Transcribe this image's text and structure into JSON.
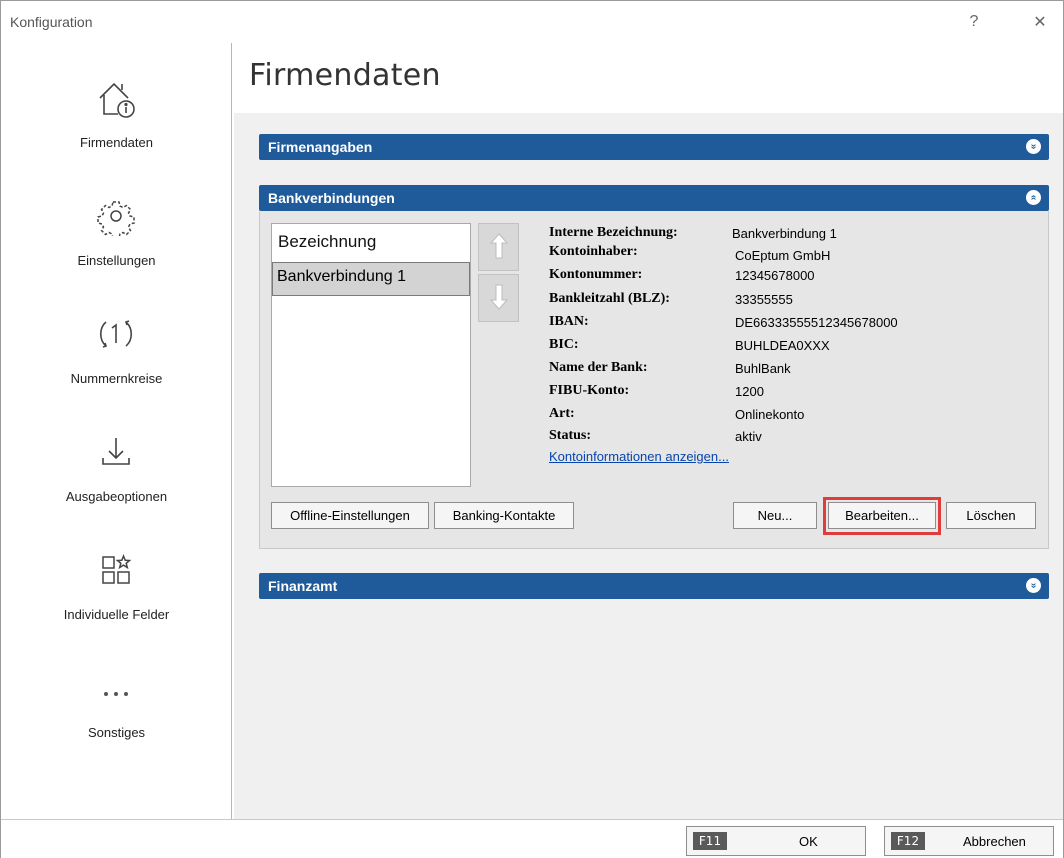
{
  "window": {
    "title": "Konfiguration",
    "help_glyph": "?",
    "close_glyph": "✕"
  },
  "sidebar": {
    "items": [
      {
        "label": "Firmendaten",
        "icon": "house-info-icon"
      },
      {
        "label": "Einstellungen",
        "icon": "gear-icon"
      },
      {
        "label": "Nummernkreise",
        "icon": "number-cycle-icon"
      },
      {
        "label": "Ausgabeoptionen",
        "icon": "download-icon"
      },
      {
        "label": "Individuelle Felder",
        "icon": "grid-star-icon"
      },
      {
        "label": "Sonstiges",
        "icon": "more-dots-icon"
      }
    ]
  },
  "main": {
    "page_title": "Firmendaten",
    "sections": {
      "firmenangaben": {
        "label": "Firmenangaben",
        "toggle": "»",
        "state": "collapsed"
      },
      "bankverbindungen": {
        "label": "Bankverbindungen",
        "toggle": "«",
        "state": "expanded"
      },
      "finanzamt": {
        "label": "Finanzamt",
        "toggle": "»",
        "state": "collapsed"
      }
    },
    "bank": {
      "list_header": "Bezeichnung",
      "rows": [
        "Bankverbindung 1"
      ],
      "details": [
        {
          "label": "Interne Bezeichnung:",
          "value": "Bankverbindung 1"
        },
        {
          "label": "Kontoinhaber:",
          "value": "CoEptum GmbH"
        },
        {
          "label": "Kontonummer:",
          "value": "12345678000"
        },
        {
          "label": "Bankleitzahl (BLZ):",
          "value": "33355555"
        },
        {
          "label": "IBAN:",
          "value": "DE66333555512345678000"
        },
        {
          "label": "BIC:",
          "value": "BUHLDEA0XXX"
        },
        {
          "label": "Name der Bank:",
          "value": "BuhlBank"
        },
        {
          "label": "FIBU-Konto:",
          "value": "1200"
        },
        {
          "label": "Art:",
          "value": "Onlinekonto"
        },
        {
          "label": "Status:",
          "value": "aktiv"
        }
      ],
      "info_link": "Kontoinformationen anzeigen...",
      "buttons": {
        "offline": "Offline-Einstellungen",
        "banking_contacts": "Banking-Kontakte",
        "new": "Neu...",
        "edit": "Bearbeiten...",
        "delete": "Löschen"
      }
    }
  },
  "footer": {
    "ok_key": "F11",
    "ok_label": "OK",
    "cancel_key": "F12",
    "cancel_label": "Abbrechen"
  },
  "colors": {
    "section_bar": "#1f5b9a",
    "highlight": "#e03c3c",
    "link": "#0645ad"
  }
}
